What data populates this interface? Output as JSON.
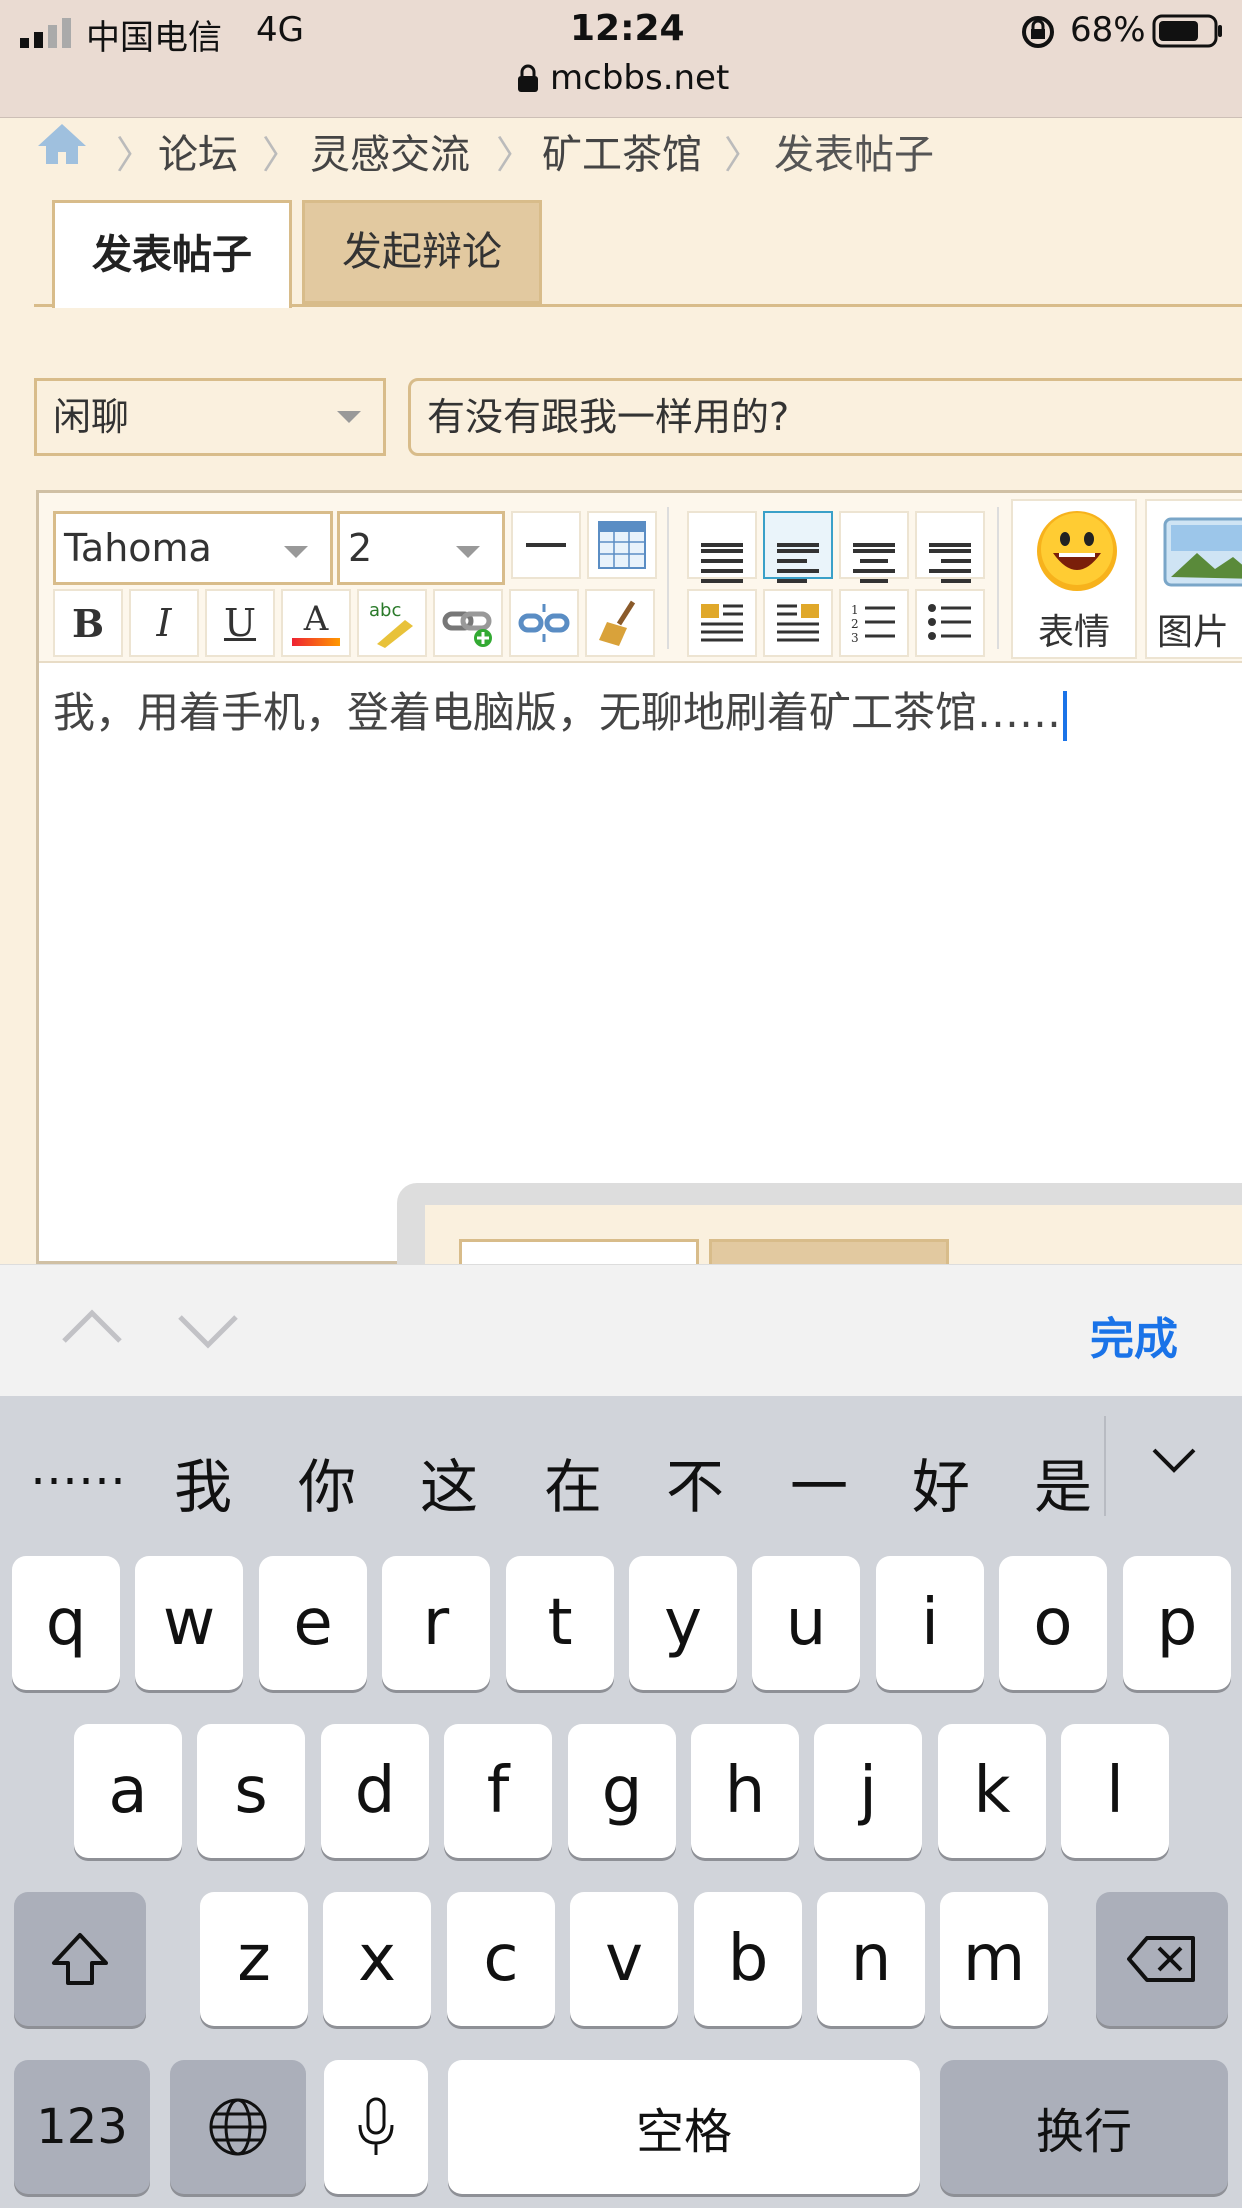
{
  "status_bar": {
    "carrier": "中国电信",
    "network": "4G",
    "time": "12:24",
    "battery": "68%",
    "url": "mcbbs.net"
  },
  "breadcrumb": [
    "论坛",
    "灵感交流",
    "矿工茶馆",
    "发表帖子"
  ],
  "tabs": [
    "发表帖子",
    "发起辩论"
  ],
  "form": {
    "category": "闲聊",
    "title_value": "有没有跟我一样用的?"
  },
  "editor": {
    "font_name": "Tahoma",
    "font_size": "2",
    "emoji_label": "表情",
    "image_label": "图片",
    "content": "我，用着手机，登着电脑版，无聊地刷着矿工茶馆……"
  },
  "accessory": {
    "done": "完成"
  },
  "keyboard": {
    "candidates": [
      "……",
      "我",
      "你",
      "这",
      "在",
      "不",
      "一",
      "好",
      "是"
    ],
    "row1": [
      "q",
      "w",
      "e",
      "r",
      "t",
      "y",
      "u",
      "i",
      "o",
      "p"
    ],
    "row2": [
      "a",
      "s",
      "d",
      "f",
      "g",
      "h",
      "j",
      "k",
      "l"
    ],
    "row3": [
      "z",
      "x",
      "c",
      "v",
      "b",
      "n",
      "m"
    ],
    "numbers": "123",
    "space": "空格",
    "return": "换行"
  },
  "colors": {
    "accent": "#1a73e8",
    "page_bg": "#faf0de",
    "border": "#d8bc8a"
  }
}
